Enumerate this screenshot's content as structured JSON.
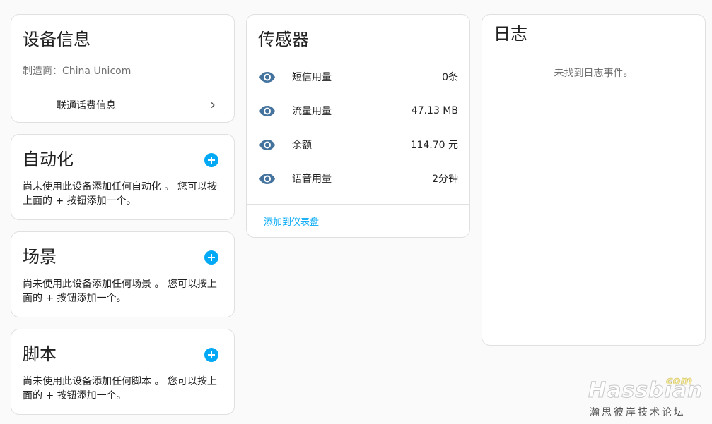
{
  "device_info": {
    "title": "设备信息",
    "manufacturer_label": "制造商：",
    "manufacturer_value": "China Unicom",
    "link_label": "联通话费信息"
  },
  "automation": {
    "title": "自动化",
    "description": "尚未使用此设备添加任何自动化 。 您可以按上面的 + 按钮添加一个。"
  },
  "scene": {
    "title": "场景",
    "description": "尚未使用此设备添加任何场景 。 您可以按上面的 + 按钮添加一个。"
  },
  "script": {
    "title": "脚本",
    "description": "尚未使用此设备添加任何脚本 。 您可以按上面的 + 按钮添加一个。"
  },
  "sensors": {
    "title": "传感器",
    "items": [
      {
        "name": "短信用量",
        "value": "0条"
      },
      {
        "name": "流量用量",
        "value": "47.13 MB"
      },
      {
        "name": "余额",
        "value": "114.70 元"
      },
      {
        "name": "语音用量",
        "value": "2分钟"
      }
    ],
    "add_to_dashboard": "添加到仪表盘"
  },
  "logbook": {
    "title": "日志",
    "empty_text": "未找到日志事件。"
  },
  "watermark": {
    "brand": "Hassbian",
    "suffix": "com",
    "subtitle": "瀚思彼岸技术论坛"
  },
  "colors": {
    "accent": "#03a9f4",
    "eye_icon": "#44739e"
  }
}
